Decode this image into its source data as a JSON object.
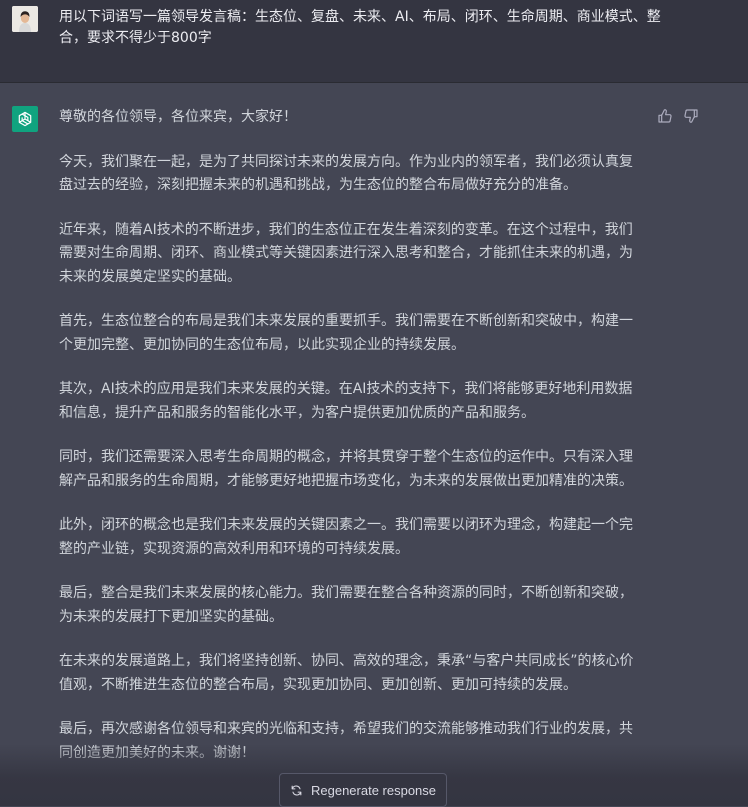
{
  "user_message": {
    "avatar_icon": "user-avatar-photo",
    "text": "用以下词语写一篇领导发言稿：生态位、复盘、未来、AI、布局、闭环、生命周期、商业模式、整合，要求不得少于800字"
  },
  "assistant_message": {
    "avatar_icon": "openai-logo-icon",
    "paragraphs": [
      "尊敬的各位领导，各位来宾，大家好！",
      "今天，我们聚在一起，是为了共同探讨未来的发展方向。作为业内的领军者，我们必须认真复盘过去的经验，深刻把握未来的机遇和挑战，为生态位的整合布局做好充分的准备。",
      "近年来，随着AI技术的不断进步，我们的生态位正在发生着深刻的变革。在这个过程中，我们需要对生命周期、闭环、商业模式等关键因素进行深入思考和整合，才能抓住未来的机遇，为未来的发展奠定坚实的基础。",
      "首先，生态位整合的布局是我们未来发展的重要抓手。我们需要在不断创新和突破中，构建一个更加完整、更加协同的生态位布局，以此实现企业的持续发展。",
      "其次，AI技术的应用是我们未来发展的关键。在AI技术的支持下，我们将能够更好地利用数据和信息，提升产品和服务的智能化水平，为客户提供更加优质的产品和服务。",
      "同时，我们还需要深入思考生命周期的概念，并将其贯穿于整个生态位的运作中。只有深入理解产品和服务的生命周期，才能够更好地把握市场变化，为未来的发展做出更加精准的决策。",
      "此外，闭环的概念也是我们未来发展的关键因素之一。我们需要以闭环为理念，构建起一个完整的产业链，实现资源的高效利用和环境的可持续发展。",
      "最后，整合是我们未来发展的核心能力。我们需要在整合各种资源的同时，不断创新和突破，为未来的发展打下更加坚实的基础。",
      "在未来的发展道路上，我们将坚持创新、协同、高效的理念，秉承“与客户共同成长”的核心价值观，不断推进生态位的整合布局，实现更加协同、更加创新、更加可持续的发展。",
      "最后，再次感谢各位领导和来宾的光临和支持，希望我们的交流能够推动我们行业的发展，共同创造更加美好的未来。谢谢！"
    ]
  },
  "actions": {
    "thumbs_up_icon": "thumbs-up-icon",
    "thumbs_down_icon": "thumbs-down-icon",
    "regenerate_label": "Regenerate response",
    "regenerate_icon": "refresh-icon"
  },
  "colors": {
    "user_bg": "#343541",
    "assistant_bg": "#444654",
    "brand": "#10a37f"
  }
}
